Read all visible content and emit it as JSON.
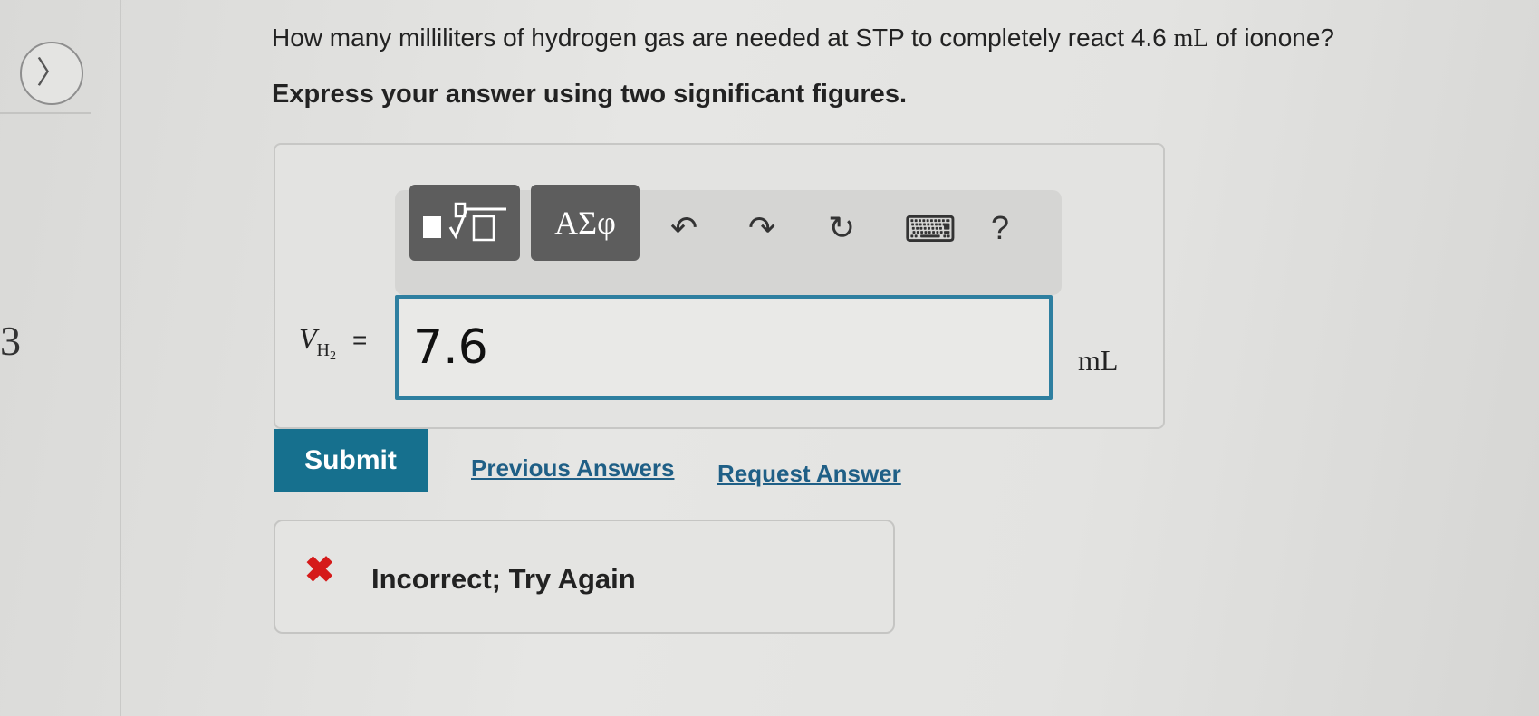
{
  "nav": {
    "next_glyph": "〉"
  },
  "sidebar": {
    "number": "3"
  },
  "question": {
    "text_before": "How many milliliters of hydrogen gas are needed at STP to completely react 4.6 ",
    "unit_math": "mL",
    "text_after": " of ionone?",
    "instruction": "Express your answer using two significant figures."
  },
  "toolbar": {
    "templates_glyph": "■ⁿ√□",
    "greek_label": "ΑΣφ",
    "undo_glyph": "↶",
    "redo_glyph": "↷",
    "reset_glyph": "↻",
    "keyboard_glyph": "⌨",
    "help_label": "?"
  },
  "answer": {
    "var_symbol": "V",
    "var_sub": "H",
    "var_sub2": "2",
    "equals": "=",
    "value": "7.6",
    "unit": "mL"
  },
  "actions": {
    "submit_label": "Submit",
    "previous_answers_label": "Previous Answers",
    "request_answer_label": "Request Answer"
  },
  "feedback": {
    "icon": "✖",
    "text": "Incorrect; Try Again"
  },
  "colors": {
    "accent": "#16708e",
    "input_border": "#2e7fa0",
    "link": "#1f5f86",
    "error": "#d51a1a"
  }
}
